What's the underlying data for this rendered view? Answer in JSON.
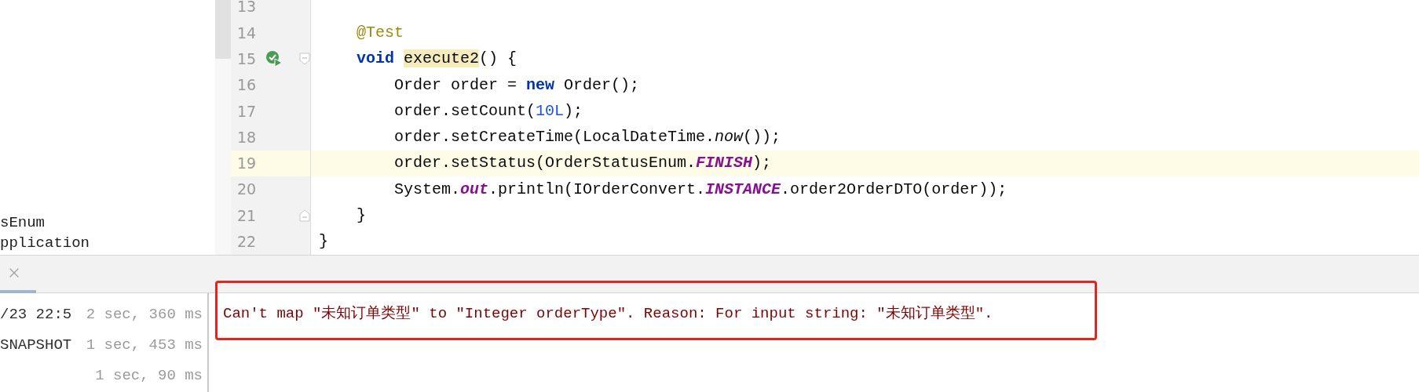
{
  "project_tree": {
    "items": [
      "sEnum",
      "pplication"
    ]
  },
  "editor": {
    "lines": [
      {
        "number": "13",
        "current": false,
        "run": false,
        "fold_start": false,
        "fold_end": false
      },
      {
        "number": "14",
        "current": false,
        "run": false,
        "fold_start": false,
        "fold_end": false,
        "tokens": [
          {
            "kind": "annotation",
            "text": "    @Test"
          }
        ]
      },
      {
        "number": "15",
        "current": false,
        "run": true,
        "fold_start": true,
        "fold_end": false,
        "tokens": [
          {
            "kind": "keyword",
            "text": "    void "
          },
          {
            "kind": "match",
            "text": "execute2"
          },
          {
            "kind": "plain",
            "text": "() {"
          }
        ]
      },
      {
        "number": "16",
        "current": false,
        "run": false,
        "fold_start": false,
        "fold_end": false,
        "tokens": [
          {
            "kind": "plain",
            "text": "        Order order = "
          },
          {
            "kind": "keyword",
            "text": "new"
          },
          {
            "kind": "plain",
            "text": " Order();"
          }
        ]
      },
      {
        "number": "17",
        "current": false,
        "run": false,
        "fold_start": false,
        "fold_end": false,
        "tokens": [
          {
            "kind": "plain",
            "text": "        order.setCount("
          },
          {
            "kind": "number",
            "text": "10L"
          },
          {
            "kind": "plain",
            "text": ");"
          }
        ]
      },
      {
        "number": "18",
        "current": false,
        "run": false,
        "fold_start": false,
        "fold_end": false,
        "tokens": [
          {
            "kind": "plain",
            "text": "        order.setCreateTime(LocalDateTime."
          },
          {
            "kind": "italic",
            "text": "now"
          },
          {
            "kind": "plain",
            "text": "());"
          }
        ]
      },
      {
        "number": "19",
        "current": true,
        "run": false,
        "fold_start": false,
        "fold_end": false,
        "tokens": [
          {
            "kind": "plain",
            "text": "        order.setStatus(OrderStatusEnum."
          },
          {
            "kind": "static",
            "text": "FINISH"
          },
          {
            "kind": "plain",
            "text": ");"
          }
        ]
      },
      {
        "number": "20",
        "current": false,
        "run": false,
        "fold_start": false,
        "fold_end": false,
        "tokens": [
          {
            "kind": "plain",
            "text": "        System."
          },
          {
            "kind": "static",
            "text": "out"
          },
          {
            "kind": "plain",
            "text": ".println(IOrderConvert."
          },
          {
            "kind": "static",
            "text": "INSTANCE"
          },
          {
            "kind": "plain",
            "text": ".order2OrderDTO(order));"
          }
        ]
      },
      {
        "number": "21",
        "current": false,
        "run": false,
        "fold_start": false,
        "fold_end": true,
        "tokens": [
          {
            "kind": "plain",
            "text": "    }"
          }
        ]
      },
      {
        "number": "22",
        "current": false,
        "run": false,
        "fold_start": false,
        "fold_end": false,
        "tokens": [
          {
            "kind": "plain",
            "text": "}"
          }
        ]
      }
    ]
  },
  "bottom_panel": {
    "tests": [
      {
        "name": "/23 22:5",
        "time": "2 sec, 360 ms"
      },
      {
        "name": "SNAPSHOT",
        "time": "1 sec, 453 ms"
      },
      {
        "time": "1 sec, 90 ms"
      }
    ],
    "console": {
      "message": "Can't map \"未知订单类型\" to \"Integer orderType\". Reason: For input string: \"未知订单类型\"."
    }
  }
}
